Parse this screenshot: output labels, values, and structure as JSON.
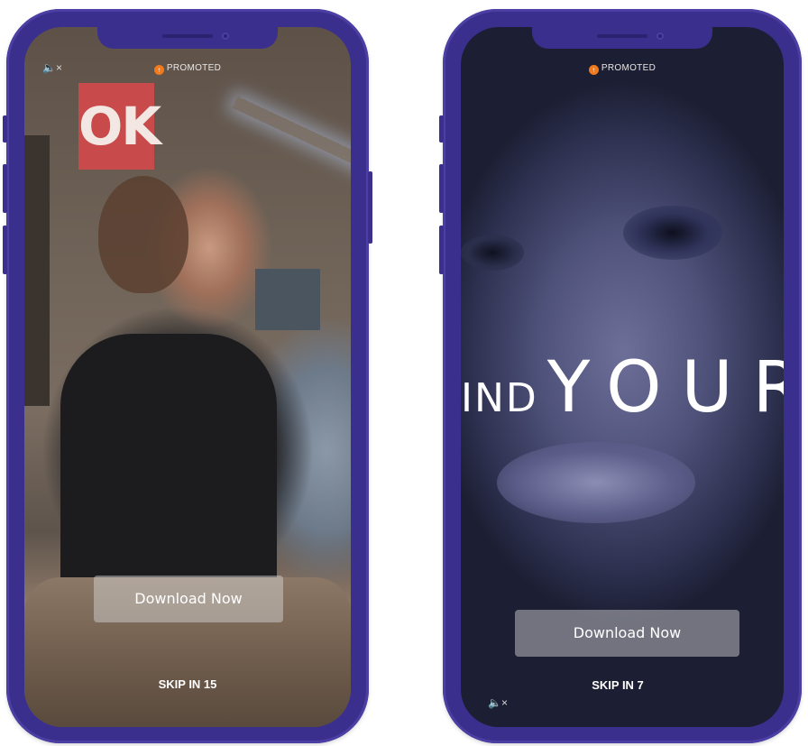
{
  "ad_left": {
    "promoted_label": "PROMOTED",
    "mute_icon": "speaker-mute-icon",
    "mute_glyph": "🔈×",
    "cta_label": "Download Now",
    "skip_label": "SKIP IN 15",
    "poster_text": "OK"
  },
  "ad_right": {
    "promoted_label": "PROMOTED",
    "mute_icon": "speaker-mute-icon",
    "mute_glyph": "🔈×",
    "cta_label": "Download Now",
    "skip_label": "SKIP IN 7",
    "overlay_text_a": "IND",
    "overlay_text_b": "YOUR"
  },
  "colors": {
    "phone_frame": "#3a2f8c",
    "promoted_badge": "#f07a1c",
    "cta_background": "rgba(220,220,220,0.45)"
  }
}
